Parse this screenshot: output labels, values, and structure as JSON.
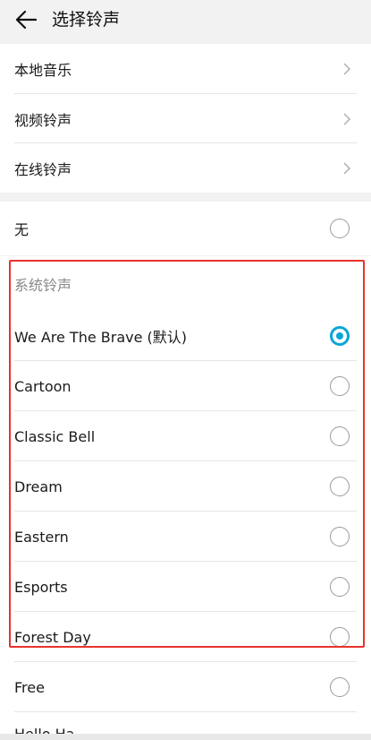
{
  "header": {
    "title": "选择铃声"
  },
  "sources": [
    {
      "label": "本地音乐"
    },
    {
      "label": "视频铃声"
    },
    {
      "label": "在线铃声"
    }
  ],
  "none_option": {
    "label": "无",
    "selected": false
  },
  "system_section": {
    "title": "系统铃声"
  },
  "ringtones": [
    {
      "label": "We Are The Brave (默认)",
      "selected": true
    },
    {
      "label": "Cartoon",
      "selected": false
    },
    {
      "label": "Classic Bell",
      "selected": false
    },
    {
      "label": "Dream",
      "selected": false
    },
    {
      "label": "Eastern",
      "selected": false
    },
    {
      "label": "Esports",
      "selected": false
    },
    {
      "label": "Forest Day",
      "selected": false
    },
    {
      "label": "Free",
      "selected": false
    },
    {
      "label": "Hello Ha",
      "selected": false
    }
  ],
  "colors": {
    "accent": "#0aa6d6",
    "highlight": "#e8332c"
  }
}
